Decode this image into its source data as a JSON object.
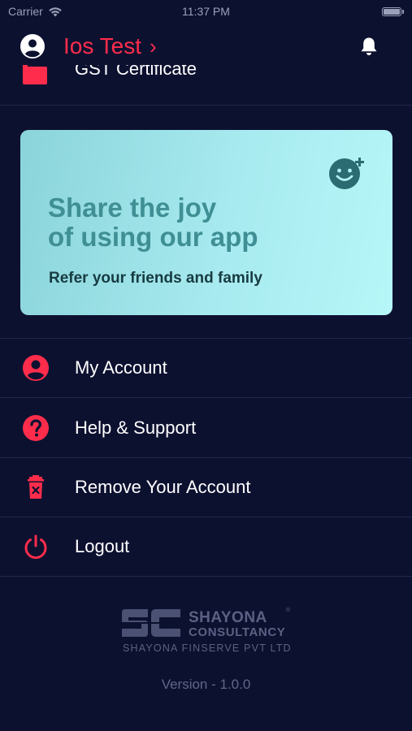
{
  "status_bar": {
    "carrier": "Carrier",
    "time": "11:37 PM"
  },
  "header": {
    "user_name": "Ios Test",
    "chevron": "›"
  },
  "partial_item": {
    "label": "GST Certificate",
    "icon": "certificate-icon"
  },
  "promo": {
    "title_line1": "Share the joy",
    "title_line2": "of using our app",
    "subtitle": "Refer your friends and family",
    "icon": "smile-plus-icon"
  },
  "menu": {
    "items": [
      {
        "label": "My Account",
        "icon": "account-icon"
      },
      {
        "label": "Help & Support",
        "icon": "help-icon"
      },
      {
        "label": "Remove Your Account",
        "icon": "trash-icon"
      },
      {
        "label": "Logout",
        "icon": "power-icon"
      }
    ]
  },
  "logo": {
    "name": "SHAYONA",
    "name2": "CONSULTANCY",
    "reg": "®",
    "tagline": "SHAYONA FINSERVE PVT LTD"
  },
  "version": "Version - 1.0.0",
  "colors": {
    "background": "#0d1130",
    "accent": "#ff2d4b",
    "promo_title": "#3f8f95",
    "promo_sub": "#173b42",
    "muted": "#5f6688"
  }
}
